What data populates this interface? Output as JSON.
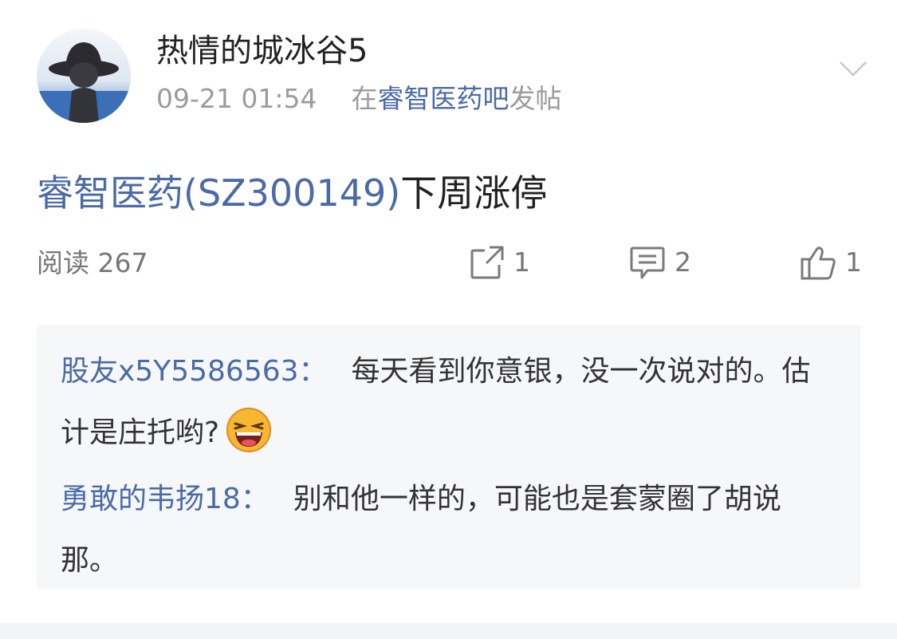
{
  "post": {
    "author": "热情的城冰谷5",
    "datetime": "09-21 01:54",
    "in_label": "在",
    "forum": "睿智医药吧",
    "post_suffix": "发帖",
    "title_stock": "睿智医药(SZ300149)",
    "title_text": "下周涨停",
    "reads": "阅读 267",
    "share_count": "1",
    "comment_count": "2",
    "like_count": "1"
  },
  "comments": [
    {
      "author": "股友x5Y5586563：",
      "text": "每天看到你意银，没一次说对的。估计是庄托哟?",
      "emoji": "laughing-emoji"
    },
    {
      "author": "勇敢的韦扬18：",
      "text": "别和他一样的，可能也是套蒙圈了胡说那。"
    }
  ],
  "colors": {
    "link_blue": "#4a6aa8",
    "meta_gray": "#9b9b9b",
    "comment_bg": "#f6f7f9"
  },
  "icons": {
    "share": "share-icon",
    "comment": "comment-icon",
    "like": "thumbs-up-icon",
    "chevron": "chevron-down-icon"
  }
}
